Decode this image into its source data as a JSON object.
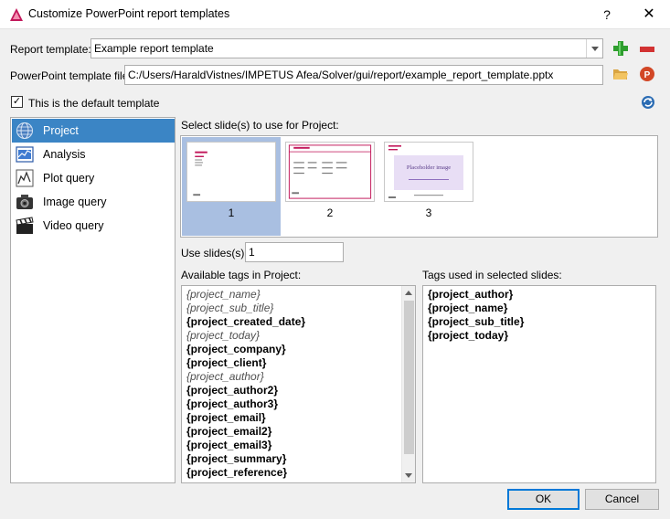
{
  "window": {
    "title": "Customize PowerPoint report templates",
    "help_label": "?",
    "close_label": "✕"
  },
  "form": {
    "report_template_label": "Report template:",
    "report_template_value": "Example report template",
    "pptx_file_label": "PowerPoint template file:",
    "pptx_file_value": "C:/Users/HaraldVistnes/IMPETUS Afea/Solver/gui/report/example_report_template.pptx",
    "default_checkbox_label": "This is the default template",
    "default_checked": true,
    "checkmark": "✓"
  },
  "categories": [
    {
      "label": "Project",
      "icon": "globe-icon",
      "selected": true
    },
    {
      "label": "Analysis",
      "icon": "analysis-icon",
      "selected": false
    },
    {
      "label": "Plot query",
      "icon": "plot-icon",
      "selected": false
    },
    {
      "label": "Image query",
      "icon": "camera-icon",
      "selected": false
    },
    {
      "label": "Video query",
      "icon": "clapperboard-icon",
      "selected": false
    }
  ],
  "slides": {
    "header": "Select slide(s) to use for Project:",
    "items": [
      {
        "number": "1",
        "selected": true
      },
      {
        "number": "2",
        "selected": false
      },
      {
        "number": "3",
        "selected": false,
        "placeholder_text": "Placeholder image"
      }
    ],
    "use_slides_label": "Use slides(s):",
    "use_slides_value": "1"
  },
  "available_tags": {
    "header": "Available tags in Project:",
    "items": [
      {
        "text": "{project_name}",
        "style": "italic"
      },
      {
        "text": "{project_sub_title}",
        "style": "italic"
      },
      {
        "text": "{project_created_date}",
        "style": "bold"
      },
      {
        "text": "{project_today}",
        "style": "italic"
      },
      {
        "text": "{project_company}",
        "style": "bold"
      },
      {
        "text": "{project_client}",
        "style": "bold"
      },
      {
        "text": "{project_author}",
        "style": "italic"
      },
      {
        "text": "{project_author2}",
        "style": "bold"
      },
      {
        "text": "{project_author3}",
        "style": "bold"
      },
      {
        "text": "{project_email}",
        "style": "bold"
      },
      {
        "text": "{project_email2}",
        "style": "bold"
      },
      {
        "text": "{project_email3}",
        "style": "bold"
      },
      {
        "text": "{project_summary}",
        "style": "bold"
      },
      {
        "text": "{project_reference}",
        "style": "bold"
      }
    ]
  },
  "used_tags": {
    "header": "Tags used in selected slides:",
    "items": [
      {
        "text": "{project_author}"
      },
      {
        "text": "{project_name}"
      },
      {
        "text": "{project_sub_title}"
      },
      {
        "text": "{project_today}"
      }
    ]
  },
  "buttons": {
    "ok": "OK",
    "cancel": "Cancel"
  },
  "colors": {
    "selection": "#3b85c5",
    "slide_selection": "#a9bfe1",
    "add_green": "#2e9e2e",
    "remove_red": "#d23232"
  }
}
